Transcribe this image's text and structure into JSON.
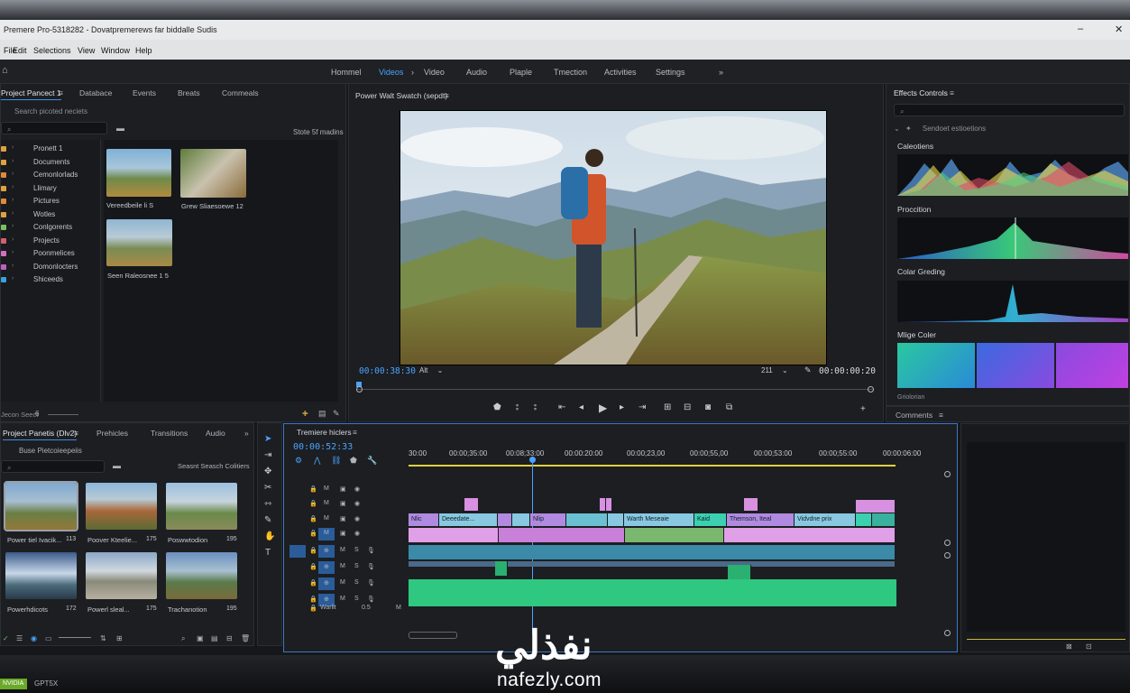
{
  "window": {
    "title": "Premere Pro-5318282 - Dovatpremerews far biddalle Sudis",
    "menu": [
      "File",
      "Edit",
      "Selections",
      "View",
      "Window",
      "Help"
    ]
  },
  "workspaces": [
    "Hommel",
    "Videos",
    "Video",
    "Audio",
    "Plaple",
    "Tmection",
    "Activities",
    "Settings"
  ],
  "workspace_active": "Videos",
  "project_panel": {
    "tabs": [
      "Project Pancect 1",
      "Databace",
      "Events",
      "Breats",
      "Commeals"
    ],
    "search_placeholder": "Search picoted neciets",
    "slots_label": "Stote 5f madins",
    "folders": [
      {
        "label": "Pronett 1",
        "color": "#e0a040"
      },
      {
        "label": "Documents",
        "color": "#e0a040"
      },
      {
        "label": "Cemonlorlads",
        "color": "#e08a3a"
      },
      {
        "label": "Llimary",
        "color": "#e0a040"
      },
      {
        "label": "Pictures",
        "color": "#e08a3a"
      },
      {
        "label": "Wotles",
        "color": "#e0a040"
      },
      {
        "label": "Conlgorents",
        "color": "#7ac060"
      },
      {
        "label": "Projects",
        "color": "#d06070"
      },
      {
        "label": "Poonmelices",
        "color": "#d070c0"
      },
      {
        "label": "Domonlocters",
        "color": "#c060c0"
      },
      {
        "label": "Shiceeds",
        "color": "#3aa0e0"
      }
    ],
    "thumbs": [
      {
        "caption": "Vereedbeile li   S"
      },
      {
        "caption": "Grew Sliaesoewe 12"
      },
      {
        "caption": "Seen Raleosnee 1 5"
      }
    ],
    "footer_left": "Jecon Seect",
    "footer_num": "6"
  },
  "program_monitor": {
    "title": "Power Walt Swatch (sepdt)",
    "timecode_left": "00:00:38:30",
    "fit_select": "Alt",
    "zoom_value": "211",
    "timecode_right": "00:00:00:20"
  },
  "effects_panel": {
    "title": "Effects Controls",
    "sub": "Sendoet estioetions",
    "sections": [
      "Caleotiens",
      "Proccition",
      "Colar Greding",
      "Mlige Coler",
      "Griolorian"
    ],
    "comments_tab": "Comments"
  },
  "media_panel": {
    "tabs": [
      "Project Panetis (Dlv2)",
      "Prehicles",
      "Transitions",
      "Audio"
    ],
    "browser_label": "Buse Pietcoieepeiis",
    "search_label": "Seasnt Seasch Colitiers",
    "items": [
      {
        "caption": "Power tiel Ivacik..."
      },
      {
        "caption": "Poover Kteelie..."
      },
      {
        "caption": "Poswwtodion"
      },
      {
        "caption": "Powerhdicots"
      },
      {
        "caption": "Powerl sleal..."
      },
      {
        "caption": "Trachanotion"
      }
    ],
    "item_nums": [
      "113",
      "175",
      "195",
      "172",
      "175",
      "195"
    ]
  },
  "timeline": {
    "title": "Tremiere hiclers",
    "timecode": "00:00:52:33",
    "ruler": [
      "30:00",
      "00:00;35:00",
      "00:08;33:00",
      "00:00:20:00",
      "00:00;23,00",
      "00:00;55,00",
      "00:00;53:00",
      "00:00;55:00",
      "00:00:06:00"
    ],
    "video_clips": [
      "Nlic",
      "Deeedate...",
      "Nlip",
      "Warth Meseaie",
      "Kaid",
      "Themson, Iteal",
      "Vidvdne prix"
    ],
    "track_footer": "Warlit",
    "track_footer_num": "0.5"
  },
  "taskbar": {
    "gpu": "NVIDIA",
    "model": "GPT5X"
  },
  "watermark": {
    "arabic": "نفذلي",
    "url": "nafezly.com"
  }
}
